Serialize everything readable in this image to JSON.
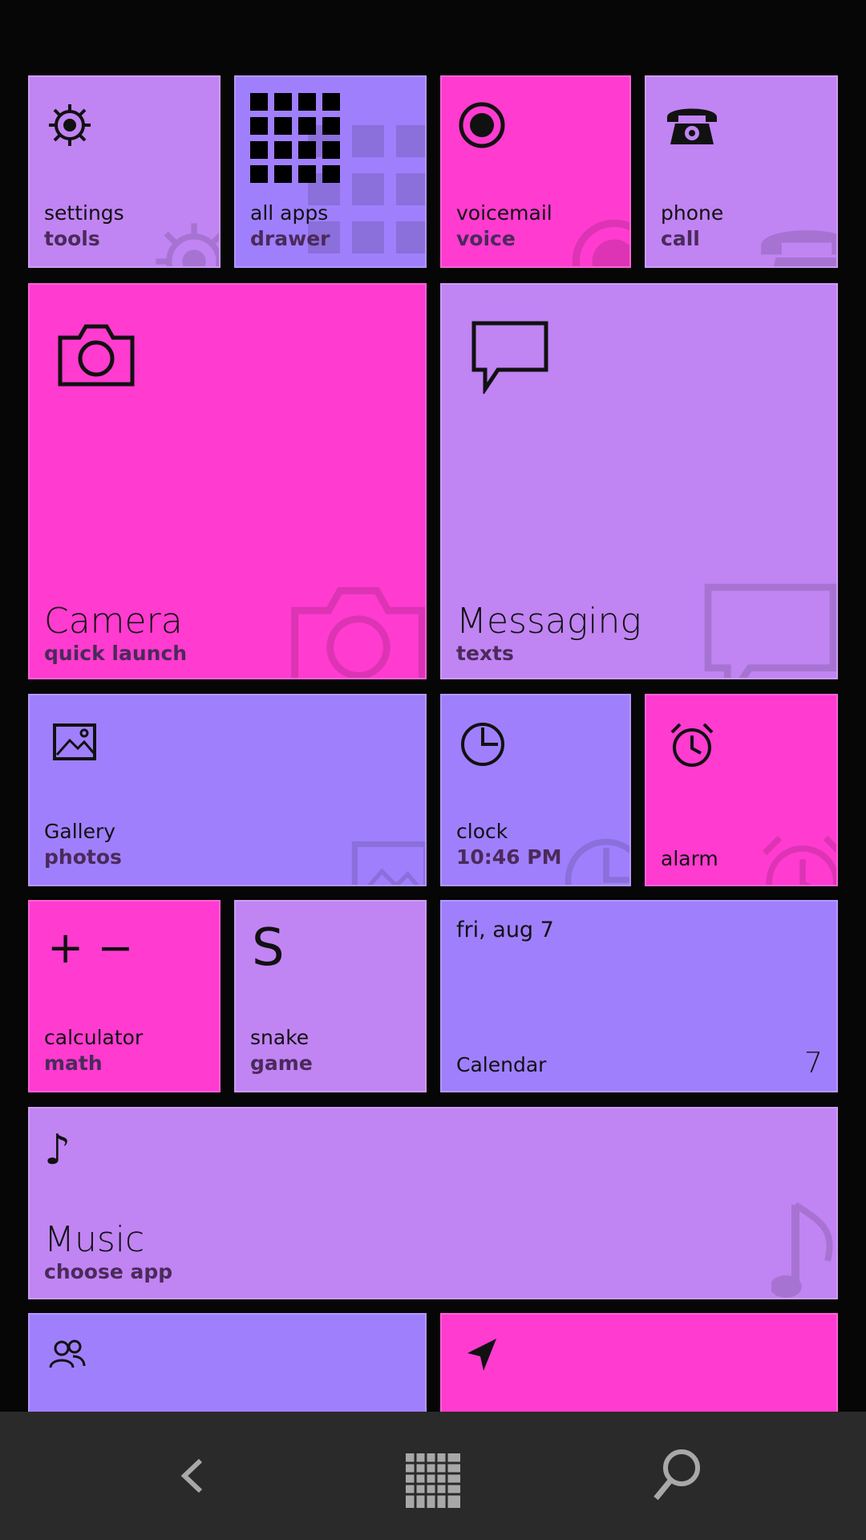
{
  "colors": {
    "lilac": "#c184f3",
    "blue": "#a07ffd",
    "pink": "#ff3bd0",
    "background": "#060606",
    "navbar": "#2a2a2a"
  },
  "tiles": {
    "settings": {
      "title": "settings",
      "subtitle": "tools",
      "icon": "gear-icon"
    },
    "all_apps": {
      "title": "all apps",
      "subtitle": "drawer",
      "icon": "app-grid-icon"
    },
    "voicemail": {
      "title": "voicemail",
      "subtitle": "voice",
      "icon": "record-icon"
    },
    "phone": {
      "title": "phone",
      "subtitle": "call",
      "icon": "telephone-icon"
    },
    "camera": {
      "title": "Camera",
      "subtitle": "quick launch",
      "icon": "camera-icon"
    },
    "messaging": {
      "title": "Messaging",
      "subtitle": "texts",
      "icon": "chat-bubble-icon"
    },
    "gallery": {
      "title": "Gallery",
      "subtitle": "photos",
      "icon": "picture-icon"
    },
    "clock": {
      "title": "clock",
      "subtitle": "10:46 PM",
      "icon": "clock-icon"
    },
    "alarm": {
      "title": "alarm",
      "icon": "alarm-clock-icon"
    },
    "calculator": {
      "title": "calculator",
      "subtitle": "math",
      "glyph": "+ −"
    },
    "snake": {
      "title": "snake",
      "subtitle": "game",
      "glyph": "S"
    },
    "calendar": {
      "title": "Calendar",
      "date": "fri, aug 7",
      "day": "7"
    },
    "music": {
      "title": "Music",
      "subtitle": "choose app",
      "glyph": "♪"
    },
    "people": {
      "icon": "people-icon"
    },
    "maps": {
      "icon": "navigation-arrow-icon"
    }
  },
  "navbar": {
    "back": "back-icon",
    "home": "grid-icon",
    "search": "search-icon"
  }
}
